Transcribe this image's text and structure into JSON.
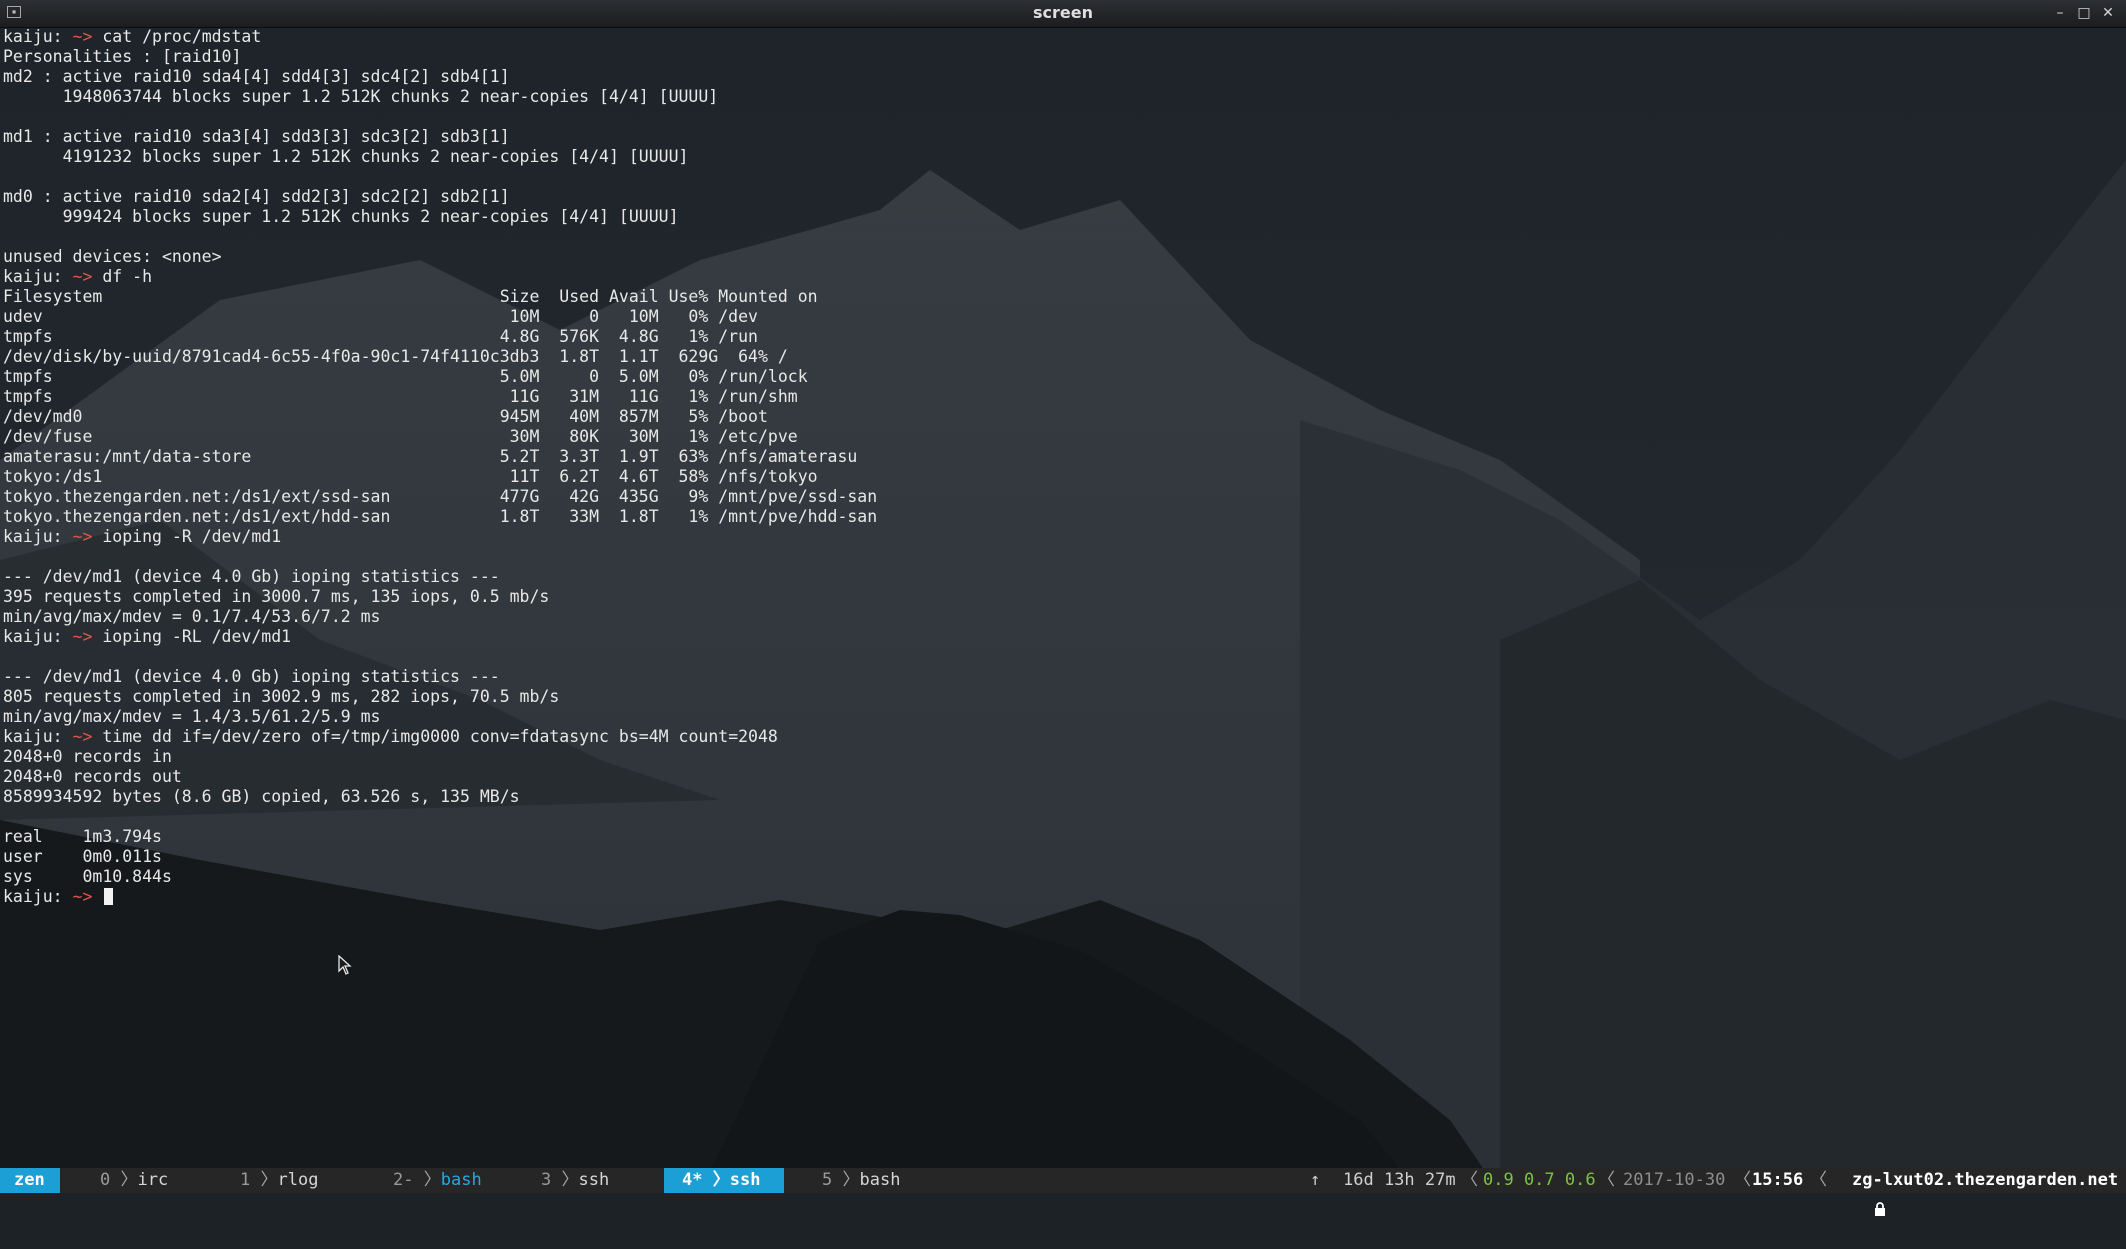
{
  "window": {
    "title": "screen",
    "app_icon": "terminal-icon",
    "controls": [
      "minimize-icon",
      "maximize-icon",
      "close-icon"
    ]
  },
  "terminal": {
    "prompt": {
      "host": "kaiju:",
      "arrow": "~>"
    },
    "cursor_line_index": 43,
    "lines": [
      {
        "t": "prompt",
        "cmd": " cat /proc/mdstat"
      },
      {
        "t": "out",
        "text": "Personalities : [raid10]"
      },
      {
        "t": "out",
        "text": "md2 : active raid10 sda4[4] sdd4[3] sdc4[2] sdb4[1]"
      },
      {
        "t": "out",
        "text": "      1948063744 blocks super 1.2 512K chunks 2 near-copies [4/4] [UUUU]"
      },
      {
        "t": "out",
        "text": ""
      },
      {
        "t": "out",
        "text": "md1 : active raid10 sda3[4] sdd3[3] sdc3[2] sdb3[1]"
      },
      {
        "t": "out",
        "text": "      4191232 blocks super 1.2 512K chunks 2 near-copies [4/4] [UUUU]"
      },
      {
        "t": "out",
        "text": ""
      },
      {
        "t": "out",
        "text": "md0 : active raid10 sda2[4] sdd2[3] sdc2[2] sdb2[1]"
      },
      {
        "t": "out",
        "text": "      999424 blocks super 1.2 512K chunks 2 near-copies [4/4] [UUUU]"
      },
      {
        "t": "out",
        "text": ""
      },
      {
        "t": "out",
        "text": "unused devices: <none>"
      },
      {
        "t": "prompt",
        "cmd": " df -h"
      },
      {
        "t": "out",
        "text": "Filesystem                                        Size  Used Avail Use% Mounted on"
      },
      {
        "t": "out",
        "text": "udev                                               10M     0   10M   0% /dev"
      },
      {
        "t": "out",
        "text": "tmpfs                                             4.8G  576K  4.8G   1% /run"
      },
      {
        "t": "out",
        "text": "/dev/disk/by-uuid/8791cad4-6c55-4f0a-90c1-74f4110c3db3  1.8T  1.1T  629G  64% /"
      },
      {
        "t": "out",
        "text": "tmpfs                                             5.0M     0  5.0M   0% /run/lock"
      },
      {
        "t": "out",
        "text": "tmpfs                                              11G   31M   11G   1% /run/shm"
      },
      {
        "t": "out",
        "text": "/dev/md0                                          945M   40M  857M   5% /boot"
      },
      {
        "t": "out",
        "text": "/dev/fuse                                          30M   80K   30M   1% /etc/pve"
      },
      {
        "t": "out",
        "text": "amaterasu:/mnt/data-store                         5.2T  3.3T  1.9T  63% /nfs/amaterasu"
      },
      {
        "t": "out",
        "text": "tokyo:/ds1                                         11T  6.2T  4.6T  58% /nfs/tokyo"
      },
      {
        "t": "out",
        "text": "tokyo.thezengarden.net:/ds1/ext/ssd-san           477G   42G  435G   9% /mnt/pve/ssd-san"
      },
      {
        "t": "out",
        "text": "tokyo.thezengarden.net:/ds1/ext/hdd-san           1.8T   33M  1.8T   1% /mnt/pve/hdd-san"
      },
      {
        "t": "prompt",
        "cmd": " ioping -R /dev/md1"
      },
      {
        "t": "out",
        "text": ""
      },
      {
        "t": "out",
        "text": "--- /dev/md1 (device 4.0 Gb) ioping statistics ---"
      },
      {
        "t": "out",
        "text": "395 requests completed in 3000.7 ms, 135 iops, 0.5 mb/s"
      },
      {
        "t": "out",
        "text": "min/avg/max/mdev = 0.1/7.4/53.6/7.2 ms"
      },
      {
        "t": "prompt",
        "cmd": " ioping -RL /dev/md1"
      },
      {
        "t": "out",
        "text": ""
      },
      {
        "t": "out",
        "text": "--- /dev/md1 (device 4.0 Gb) ioping statistics ---"
      },
      {
        "t": "out",
        "text": "805 requests completed in 3002.9 ms, 282 iops, 70.5 mb/s"
      },
      {
        "t": "out",
        "text": "min/avg/max/mdev = 1.4/3.5/61.2/5.9 ms"
      },
      {
        "t": "prompt",
        "cmd": " time dd if=/dev/zero of=/tmp/img0000 conv=fdatasync bs=4M count=2048"
      },
      {
        "t": "out",
        "text": "2048+0 records in"
      },
      {
        "t": "out",
        "text": "2048+0 records out"
      },
      {
        "t": "out",
        "text": "8589934592 bytes (8.6 GB) copied, 63.526 s, 135 MB/s"
      },
      {
        "t": "out",
        "text": ""
      },
      {
        "t": "out",
        "text": "real    1m3.794s"
      },
      {
        "t": "out",
        "text": "user    0m0.011s"
      },
      {
        "t": "out",
        "text": "sys     0m10.844s"
      },
      {
        "t": "prompt",
        "cmd": " "
      }
    ]
  },
  "statusbar": {
    "session": "zen",
    "windows": [
      {
        "num": "0",
        "name": "irc"
      },
      {
        "num": "1",
        "name": "rlog"
      },
      {
        "num": "2-",
        "name": "bash"
      },
      {
        "num": "3",
        "name": "ssh"
      },
      {
        "num": "4*",
        "name": "ssh"
      },
      {
        "num": "5",
        "name": "bash"
      }
    ],
    "uptime_arrow": "↑",
    "uptime": "16d 13h 27m",
    "load": "0.9 0.7 0.6",
    "date": "2017-10-30",
    "time": "15:56",
    "lock_icon": "lock-icon",
    "host": "zg-lxut02.thezengarden.net"
  },
  "colors": {
    "background": "#1d2227",
    "prompt_arrow": "#e2574c",
    "session_badge": "#1b9fd4",
    "active_window": "#1b9fd4",
    "load_average": "#7cc242"
  }
}
